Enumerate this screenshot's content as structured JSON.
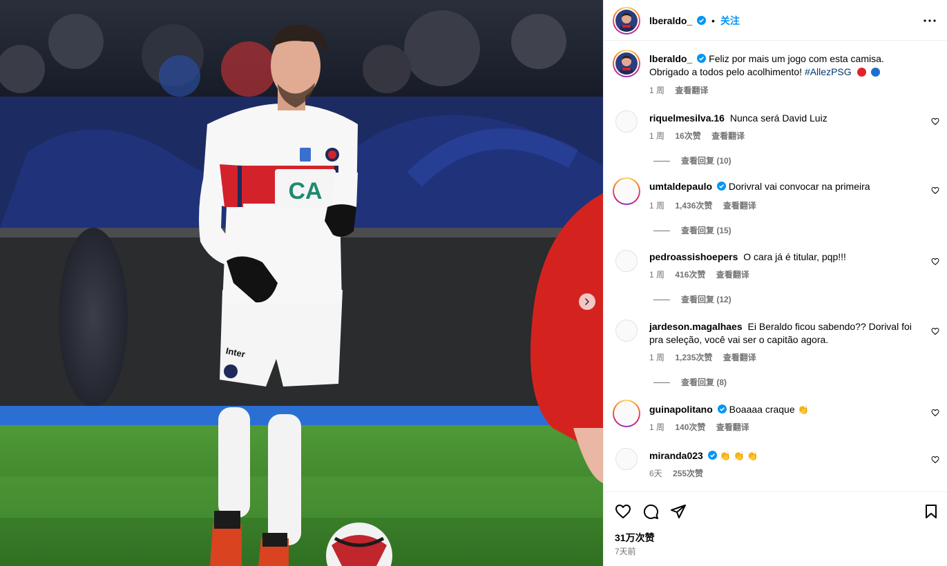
{
  "post": {
    "author": "lberaldo_",
    "follow_label": "关注",
    "separator": "•",
    "caption_text": "Feliz por mais um jogo com esta camisa. Obrigado a todos pelo acolhimento!",
    "caption_hashtag": "#AllezPSG",
    "caption_time": "1 周",
    "caption_translate": "查看翻译",
    "likes": "31万次赞",
    "posted": "7天前",
    "image_alt_jersey_sponsor": "CA"
  },
  "comments": [
    {
      "user": "riquelmesilva.16",
      "verified": false,
      "ring": false,
      "text": "Nunca será David Luiz",
      "time": "1 周",
      "likes": "16次赞",
      "translate": "查看翻译",
      "replies": "查看回复 (10)"
    },
    {
      "user": "umtaldepaulo",
      "verified": true,
      "ring": true,
      "text": "Dorivral vai convocar na primeira",
      "time": "1 周",
      "likes": "1,436次赞",
      "translate": "查看翻译",
      "replies": "查看回复 (15)"
    },
    {
      "user": "pedroassishoepers",
      "verified": false,
      "ring": false,
      "text": "O cara já é titular, pqp!!!",
      "time": "1 周",
      "likes": "416次赞",
      "translate": "查看翻译",
      "replies": "查看回复 (12)"
    },
    {
      "user": "jardeson.magalhaes",
      "verified": false,
      "ring": false,
      "text": "Ei Beraldo ficou sabendo?? Dorival foi pra seleção, você vai ser o capitão agora.",
      "time": "1 周",
      "likes": "1,235次赞",
      "translate": "查看翻译",
      "replies": "查看回复 (8)"
    },
    {
      "user": "guinapolitano",
      "verified": true,
      "ring": true,
      "text": "Boaaaa craque",
      "emoji": "👏",
      "time": "1 周",
      "likes": "140次赞",
      "translate": "查看翻译"
    },
    {
      "user": "miranda023",
      "verified": true,
      "ring": false,
      "text": "",
      "emoji": "👏 👏 👏",
      "time": "6天",
      "likes": "255次赞"
    }
  ],
  "icons": {
    "like": "heart-icon",
    "comment": "comment-icon",
    "share": "send-icon",
    "save": "bookmark-icon",
    "more": "more-options-icon",
    "next": "chevron-right-icon"
  },
  "colors": {
    "accent": "#0095f6",
    "secondary_text": "#737373",
    "hashtag": "#00376b",
    "border": "#efefef"
  }
}
